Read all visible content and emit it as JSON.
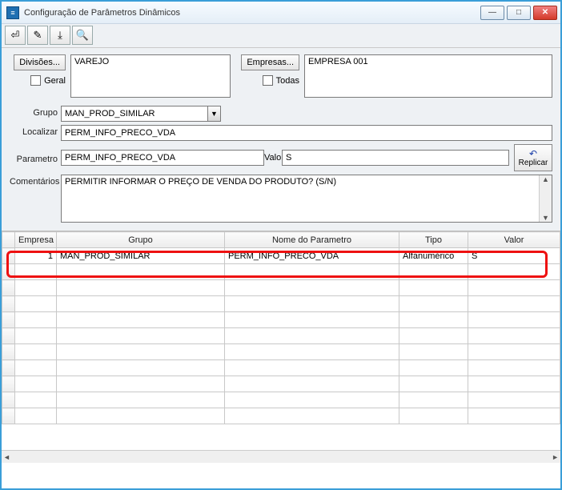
{
  "window": {
    "title": "Configuração de Parâmetros Dinâmicos"
  },
  "toolbar": {
    "icons": [
      "exit-icon",
      "eraser-icon",
      "save-icon",
      "binoculars-icon"
    ]
  },
  "top": {
    "divisoes_btn": "Divisões...",
    "divisoes_value": "VAREJO",
    "geral_label": "Geral",
    "empresas_btn": "Empresas...",
    "empresas_value": "EMPRESA 001",
    "todas_label": "Todas"
  },
  "form": {
    "grupo_label": "Grupo",
    "grupo_value": "MAN_PROD_SIMILAR",
    "localizar_label": "Localizar",
    "localizar_value": "PERM_INFO_PRECO_VDA",
    "parametro_label": "Parametro",
    "parametro_value": "PERM_INFO_PRECO_VDA",
    "valor_label": "Valor",
    "valor_value": "S",
    "replicar_label": "Replicar",
    "comentarios_label": "Comentários",
    "comentarios_value": "PERMITIR INFORMAR O PREÇO DE VENDA DO PRODUTO? (S/N)"
  },
  "grid": {
    "headers": {
      "empresa": "Empresa",
      "grupo": "Grupo",
      "nome": "Nome do Parametro",
      "tipo": "Tipo",
      "valor": "Valor"
    },
    "rows": [
      {
        "empresa": "1",
        "grupo": "MAN_PROD_SIMILAR",
        "nome": "PERM_INFO_PRECO_VDA",
        "tipo": "Alfanumérico",
        "valor": "S"
      }
    ]
  }
}
